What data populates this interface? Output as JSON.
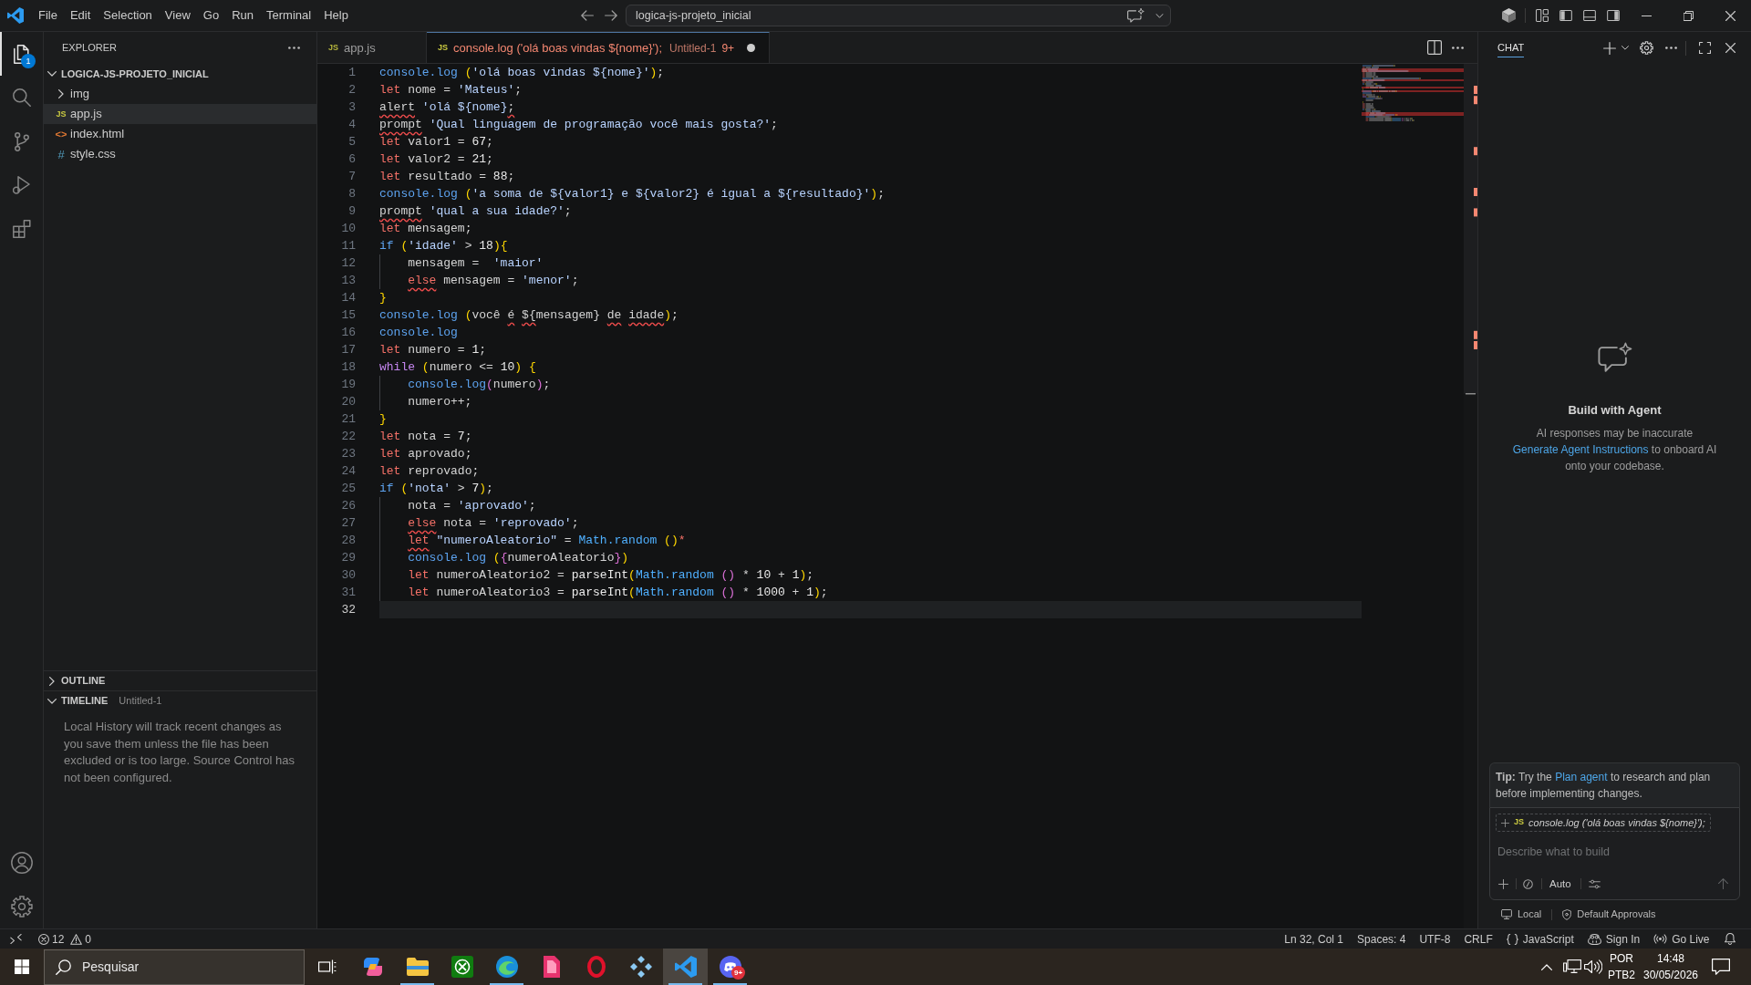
{
  "title_bar": {
    "menu": [
      "File",
      "Edit",
      "Selection",
      "View",
      "Go",
      "Run",
      "Terminal",
      "Help"
    ],
    "command_center": "logica-js-projeto_inicial"
  },
  "activity_bar": {
    "items": [
      {
        "kind": "files",
        "selected": true,
        "badge": "1"
      },
      {
        "kind": "search",
        "selected": false
      },
      {
        "kind": "branch",
        "selected": false
      },
      {
        "kind": "run",
        "selected": false
      },
      {
        "kind": "extensions",
        "selected": false
      }
    ],
    "bottom": [
      {
        "kind": "account"
      },
      {
        "kind": "settings"
      }
    ]
  },
  "sidebar": {
    "title": "EXPLORER",
    "tree": [
      {
        "label": "LOGICA-JS-PROJETO_INICIAL",
        "kind": "root",
        "expanded": true,
        "selected": false,
        "children": [
          {
            "label": "img",
            "kind": "folder",
            "expanded": false,
            "selected": false
          },
          {
            "label": "app.js",
            "kind": "js",
            "icon": "JS",
            "selected": true
          },
          {
            "label": "index.html",
            "kind": "html",
            "icon": "<>",
            "selected": false
          },
          {
            "label": "style.css",
            "kind": "css",
            "icon": "#",
            "selected": false
          }
        ]
      }
    ],
    "sections": [
      {
        "label": "OUTLINE",
        "expanded": false
      },
      {
        "label": "TIMELINE",
        "expanded": true,
        "description": "Untitled-1",
        "message": "Local History will track recent changes as you save them unless the file has been excluded or is too large. Source Control has not been configured."
      }
    ]
  },
  "editor": {
    "tabs": [
      {
        "icon": "JS",
        "label": "app.js",
        "selected": false,
        "modified": false,
        "has_errors": false
      },
      {
        "icon": "JS",
        "label": "console.log ('olá boas vindas ${nome}');",
        "description": "Untitled-1",
        "problems": "9+",
        "selected": true,
        "modified": true,
        "has_errors": true
      }
    ],
    "lines": [
      {
        "number": "1",
        "current": false,
        "tokens": [
          {
            "text": "console.log ",
            "kind": "method",
            "error": false
          },
          {
            "text": "(",
            "kind": "bracket1",
            "error": false
          },
          {
            "text": "'olá boas vindas ${nome}'",
            "kind": "string",
            "error": false
          },
          {
            "text": ")",
            "kind": "bracket1",
            "error": false
          },
          {
            "text": ";",
            "kind": "plain",
            "error": false
          }
        ]
      },
      {
        "number": "2",
        "current": false,
        "tokens": [
          {
            "text": "let",
            "kind": "storage",
            "error": false
          },
          {
            "text": " nome = ",
            "kind": "plain",
            "error": false
          },
          {
            "text": "'Mateus'",
            "kind": "string",
            "error": false
          },
          {
            "text": ";",
            "kind": "plain",
            "error": false
          }
        ]
      },
      {
        "number": "3",
        "current": false,
        "tokens": [
          {
            "text": "alert",
            "kind": "plain",
            "error": true
          },
          {
            "text": " 'olá ${nome}",
            "kind": "string",
            "error": false
          },
          {
            "text": ";",
            "kind": "plain",
            "error": true
          }
        ]
      },
      {
        "number": "4",
        "current": false,
        "tokens": [
          {
            "text": "prompt",
            "kind": "plain",
            "error": true
          },
          {
            "text": " 'Qual linguagem de programação você mais gosta?'",
            "kind": "string",
            "error": false
          },
          {
            "text": ";",
            "kind": "plain",
            "error": false
          }
        ]
      },
      {
        "number": "5",
        "current": false,
        "tokens": [
          {
            "text": "let",
            "kind": "storage",
            "error": false
          },
          {
            "text": " valor1 = ",
            "kind": "plain",
            "error": false
          },
          {
            "text": "67",
            "kind": "number",
            "error": false
          },
          {
            "text": ";",
            "kind": "plain",
            "error": false
          }
        ]
      },
      {
        "number": "6",
        "current": false,
        "tokens": [
          {
            "text": "let",
            "kind": "storage",
            "error": false
          },
          {
            "text": " valor2 = ",
            "kind": "plain",
            "error": false
          },
          {
            "text": "21",
            "kind": "number",
            "error": false
          },
          {
            "text": ";",
            "kind": "plain",
            "error": false
          }
        ]
      },
      {
        "number": "7",
        "current": false,
        "tokens": [
          {
            "text": "let",
            "kind": "storage",
            "error": false
          },
          {
            "text": " resultado = ",
            "kind": "plain",
            "error": false
          },
          {
            "text": "88",
            "kind": "number",
            "error": false
          },
          {
            "text": ";",
            "kind": "plain",
            "error": false
          }
        ]
      },
      {
        "number": "8",
        "current": false,
        "tokens": [
          {
            "text": "console.log ",
            "kind": "method",
            "error": false
          },
          {
            "text": "(",
            "kind": "bracket1",
            "error": false
          },
          {
            "text": "'a soma de ${valor1} e ${valor2} é igual a ${resultado}'",
            "kind": "string",
            "error": false
          },
          {
            "text": ")",
            "kind": "bracket1",
            "error": false
          },
          {
            "text": ";",
            "kind": "plain",
            "error": false
          }
        ]
      },
      {
        "number": "9",
        "current": false,
        "tokens": [
          {
            "text": "prompt",
            "kind": "plain",
            "error": true
          },
          {
            "text": " 'qual a sua idade?'",
            "kind": "string",
            "error": false
          },
          {
            "text": ";",
            "kind": "plain",
            "error": false
          }
        ]
      },
      {
        "number": "10",
        "current": false,
        "tokens": [
          {
            "text": "let",
            "kind": "storage",
            "error": false
          },
          {
            "text": " mensagem;",
            "kind": "plain",
            "error": false
          }
        ]
      },
      {
        "number": "11",
        "current": false,
        "tokens": [
          {
            "text": "if ",
            "kind": "conditional",
            "error": false
          },
          {
            "text": "(",
            "kind": "bracket1",
            "error": false
          },
          {
            "text": "'idade'",
            "kind": "string",
            "error": false
          },
          {
            "text": " > ",
            "kind": "plain",
            "error": false
          },
          {
            "text": "18",
            "kind": "number",
            "error": false
          },
          {
            "text": ")",
            "kind": "bracket1",
            "error": false
          },
          {
            "text": "{",
            "kind": "bracket1",
            "error": false
          }
        ],
        "children": [
          {
            "number": "12",
            "current": false,
            "tokens": [
              {
                "text": "mensagem =  ",
                "kind": "plain",
                "error": false
              },
              {
                "text": "'maior'",
                "kind": "string",
                "error": false
              }
            ]
          },
          {
            "number": "13",
            "current": false,
            "tokens": [
              {
                "text": "else",
                "kind": "storage",
                "error": true
              },
              {
                "text": " mensagem = ",
                "kind": "plain",
                "error": false
              },
              {
                "text": "'menor'",
                "kind": "string",
                "error": false
              },
              {
                "text": ";",
                "kind": "plain",
                "error": false
              }
            ]
          }
        ]
      },
      {
        "number": "14",
        "current": false,
        "tokens": [
          {
            "text": "}",
            "kind": "bracket1",
            "error": false
          }
        ]
      },
      {
        "number": "15",
        "current": false,
        "tokens": [
          {
            "text": "console.log ",
            "kind": "method",
            "error": false
          },
          {
            "text": "(",
            "kind": "bracket1",
            "error": false
          },
          {
            "text": "você ",
            "kind": "plain",
            "error": false
          },
          {
            "text": "é ",
            "kind": "plain",
            "error": true
          },
          {
            "text": "${",
            "kind": "plain",
            "error": true
          },
          {
            "text": "mensagem} ",
            "kind": "plain",
            "error": false
          },
          {
            "text": "de ",
            "kind": "plain",
            "error": true
          },
          {
            "text": "idade",
            "kind": "plain",
            "error": true
          },
          {
            "text": ")",
            "kind": "bracket1",
            "error": false
          },
          {
            "text": ";",
            "kind": "plain",
            "error": false
          }
        ]
      },
      {
        "number": "16",
        "current": false,
        "tokens": [
          {
            "text": "console.log",
            "kind": "method",
            "error": false
          }
        ]
      },
      {
        "number": "17",
        "current": false,
        "tokens": [
          {
            "text": "let",
            "kind": "storage",
            "error": false
          },
          {
            "text": " numero = ",
            "kind": "plain",
            "error": false
          },
          {
            "text": "1",
            "kind": "number",
            "error": false
          },
          {
            "text": ";",
            "kind": "plain",
            "error": false
          }
        ]
      },
      {
        "number": "18",
        "current": false,
        "tokens": [
          {
            "text": "while ",
            "kind": "loop",
            "error": false
          },
          {
            "text": "(",
            "kind": "bracket1",
            "error": false
          },
          {
            "text": "numero <= ",
            "kind": "plain",
            "error": false
          },
          {
            "text": "10",
            "kind": "number",
            "error": false
          },
          {
            "text": ") ",
            "kind": "bracket1",
            "error": false
          },
          {
            "text": "{",
            "kind": "bracket1",
            "error": false
          }
        ],
        "children": [
          {
            "number": "19",
            "current": false,
            "tokens": [
              {
                "text": "console.log",
                "kind": "method",
                "error": false
              },
              {
                "text": "(",
                "kind": "bracket2",
                "error": false
              },
              {
                "text": "numero",
                "kind": "plain",
                "error": false
              },
              {
                "text": ")",
                "kind": "bracket2",
                "error": false
              },
              {
                "text": ";",
                "kind": "plain",
                "error": false
              }
            ]
          },
          {
            "number": "20",
            "current": false,
            "tokens": [
              {
                "text": "numero++;",
                "kind": "plain",
                "error": false
              }
            ]
          }
        ]
      },
      {
        "number": "21",
        "current": false,
        "tokens": [
          {
            "text": "}",
            "kind": "bracket1",
            "error": false
          }
        ]
      },
      {
        "number": "22",
        "current": false,
        "tokens": [
          {
            "text": "let",
            "kind": "storage",
            "error": false
          },
          {
            "text": " nota = ",
            "kind": "plain",
            "error": false
          },
          {
            "text": "7",
            "kind": "number",
            "error": false
          },
          {
            "text": ";",
            "kind": "plain",
            "error": false
          }
        ]
      },
      {
        "number": "23",
        "current": false,
        "tokens": [
          {
            "text": "let",
            "kind": "storage",
            "error": false
          },
          {
            "text": " aprovado;",
            "kind": "plain",
            "error": false
          }
        ]
      },
      {
        "number": "24",
        "current": false,
        "tokens": [
          {
            "text": "let",
            "kind": "storage",
            "error": false
          },
          {
            "text": " reprovado;",
            "kind": "plain",
            "error": false
          }
        ]
      },
      {
        "number": "25",
        "current": false,
        "tokens": [
          {
            "text": "if ",
            "kind": "conditional",
            "error": false
          },
          {
            "text": "(",
            "kind": "bracket1",
            "error": false
          },
          {
            "text": "'nota'",
            "kind": "string",
            "error": false
          },
          {
            "text": " > ",
            "kind": "plain",
            "error": false
          },
          {
            "text": "7",
            "kind": "number",
            "error": false
          },
          {
            "text": ")",
            "kind": "bracket1",
            "error": false
          },
          {
            "text": ";",
            "kind": "plain",
            "error": false
          }
        ],
        "children": [
          {
            "number": "26",
            "current": false,
            "tokens": [
              {
                "text": "nota = ",
                "kind": "plain",
                "error": false
              },
              {
                "text": "'aprovado'",
                "kind": "string",
                "error": false
              },
              {
                "text": ";",
                "kind": "plain",
                "error": false
              }
            ]
          },
          {
            "number": "27",
            "current": false,
            "tokens": [
              {
                "text": "else",
                "kind": "storage",
                "error": true
              },
              {
                "text": " nota = ",
                "kind": "plain",
                "error": false
              },
              {
                "text": "'reprovado'",
                "kind": "string",
                "error": false
              },
              {
                "text": ";",
                "kind": "plain",
                "error": false
              }
            ]
          },
          {
            "number": "28",
            "current": false,
            "tokens": [
              {
                "text": "let",
                "kind": "storage",
                "error": true
              },
              {
                "text": " \"numeroAleatorio\"",
                "kind": "string",
                "error": false
              },
              {
                "text": " = ",
                "kind": "plain",
                "error": false
              },
              {
                "text": "Math.random ",
                "kind": "builtin",
                "error": false
              },
              {
                "text": "()",
                "kind": "bracket1",
                "error": false
              },
              {
                "text": "*",
                "kind": "invalid",
                "error": false
              }
            ]
          },
          {
            "number": "29",
            "current": false,
            "tokens": [
              {
                "text": "console.log ",
                "kind": "method",
                "error": false
              },
              {
                "text": "(",
                "kind": "bracket1",
                "error": false
              },
              {
                "text": "{",
                "kind": "bracket2",
                "error": false
              },
              {
                "text": "numeroAleatorio",
                "kind": "plain",
                "error": false
              },
              {
                "text": "}",
                "kind": "bracket2",
                "error": false
              },
              {
                "text": ")",
                "kind": "bracket1",
                "error": false
              }
            ]
          },
          {
            "number": "30",
            "current": false,
            "tokens": [
              {
                "text": "let",
                "kind": "storage",
                "error": false
              },
              {
                "text": " numeroAleatorio2 = ",
                "kind": "plain",
                "error": false
              },
              {
                "text": "parseInt",
                "kind": "function",
                "error": false
              },
              {
                "text": "(",
                "kind": "bracket1",
                "error": false
              },
              {
                "text": "Math.random ",
                "kind": "builtin",
                "error": false
              },
              {
                "text": "()",
                "kind": "bracket2",
                "error": false
              },
              {
                "text": " * ",
                "kind": "plain",
                "error": false
              },
              {
                "text": "10",
                "kind": "number",
                "error": false
              },
              {
                "text": " + ",
                "kind": "plain",
                "error": false
              },
              {
                "text": "1",
                "kind": "number",
                "error": false
              },
              {
                "text": ")",
                "kind": "bracket1",
                "error": false
              },
              {
                "text": ";",
                "kind": "plain",
                "error": false
              }
            ]
          },
          {
            "number": "31",
            "current": false,
            "tokens": [
              {
                "text": "let",
                "kind": "storage",
                "error": false
              },
              {
                "text": " numeroAleatorio3 = ",
                "kind": "plain",
                "error": false
              },
              {
                "text": "parseInt",
                "kind": "function",
                "error": false
              },
              {
                "text": "(",
                "kind": "bracket1",
                "error": false
              },
              {
                "text": "Math.random ",
                "kind": "builtin",
                "error": false
              },
              {
                "text": "()",
                "kind": "bracket2",
                "error": false
              },
              {
                "text": " * ",
                "kind": "plain",
                "error": false
              },
              {
                "text": "1000",
                "kind": "number",
                "error": false
              },
              {
                "text": " + ",
                "kind": "plain",
                "error": false
              },
              {
                "text": "1",
                "kind": "number",
                "error": false
              },
              {
                "text": ")",
                "kind": "bracket1",
                "error": false
              },
              {
                "text": ";",
                "kind": "plain",
                "error": false
              }
            ]
          }
        ]
      },
      {
        "number": "32",
        "current": true
      }
    ]
  },
  "chat": {
    "tabs": [
      {
        "label": "CHAT",
        "selected": true
      }
    ],
    "heading": "Build with Agent",
    "disclaimer": "AI responses may be inaccurate",
    "instructions": {
      "link": "Generate Agent Instructions",
      "text": "to onboard AI onto your codebase."
    },
    "tip": {
      "text_before": "**Tip:** Try the",
      "link": "Plan agent",
      "text_after": "to research and plan before implementing changes."
    },
    "context_chip": {
      "icon": "JS",
      "label": "console.log ('olá boas vindas ${nome}');"
    },
    "input": {
      "placeholder": "Describe what to build"
    },
    "mode": "Auto",
    "footer": [
      {
        "kind": "local",
        "label": "Local"
      },
      {
        "kind": "approvals",
        "label": "Default Approvals"
      }
    ]
  },
  "status_bar": {
    "problems": {
      "errors": "12",
      "warnings": "0"
    },
    "items": [
      {
        "kind": "text",
        "label": "Ln 32, Col 1"
      },
      {
        "kind": "text",
        "label": "Spaces: 4"
      },
      {
        "kind": "text",
        "label": "UTF-8"
      },
      {
        "kind": "text",
        "label": "CRLF"
      },
      {
        "kind": "language",
        "label": "JavaScript"
      },
      {
        "kind": "account",
        "label": "Sign In"
      },
      {
        "kind": "live",
        "label": "Go Live"
      },
      {
        "kind": "bell"
      }
    ]
  },
  "taskbar": {
    "search": {
      "placeholder": "Pesquisar"
    },
    "apps": [
      {
        "kind": "stacked-shapes",
        "running": false,
        "active": false
      },
      {
        "kind": "folder",
        "running": true,
        "active": false
      },
      {
        "kind": "x-circle",
        "running": false,
        "active": false
      },
      {
        "kind": "wave",
        "running": true,
        "active": false
      },
      {
        "kind": "folded-square",
        "running": false,
        "active": false
      },
      {
        "kind": "ring",
        "running": false,
        "active": false
      },
      {
        "kind": "cross-cluster",
        "running": false,
        "active": false
      },
      {
        "kind": "ribbon",
        "running": true,
        "active": true
      },
      {
        "kind": "gamepad-face",
        "running": true,
        "active": false,
        "badge": "9+"
      }
    ],
    "tray": {
      "language": "POR",
      "layout": "PTB2",
      "time": "14:48",
      "date": "30/05/2026"
    }
  }
}
